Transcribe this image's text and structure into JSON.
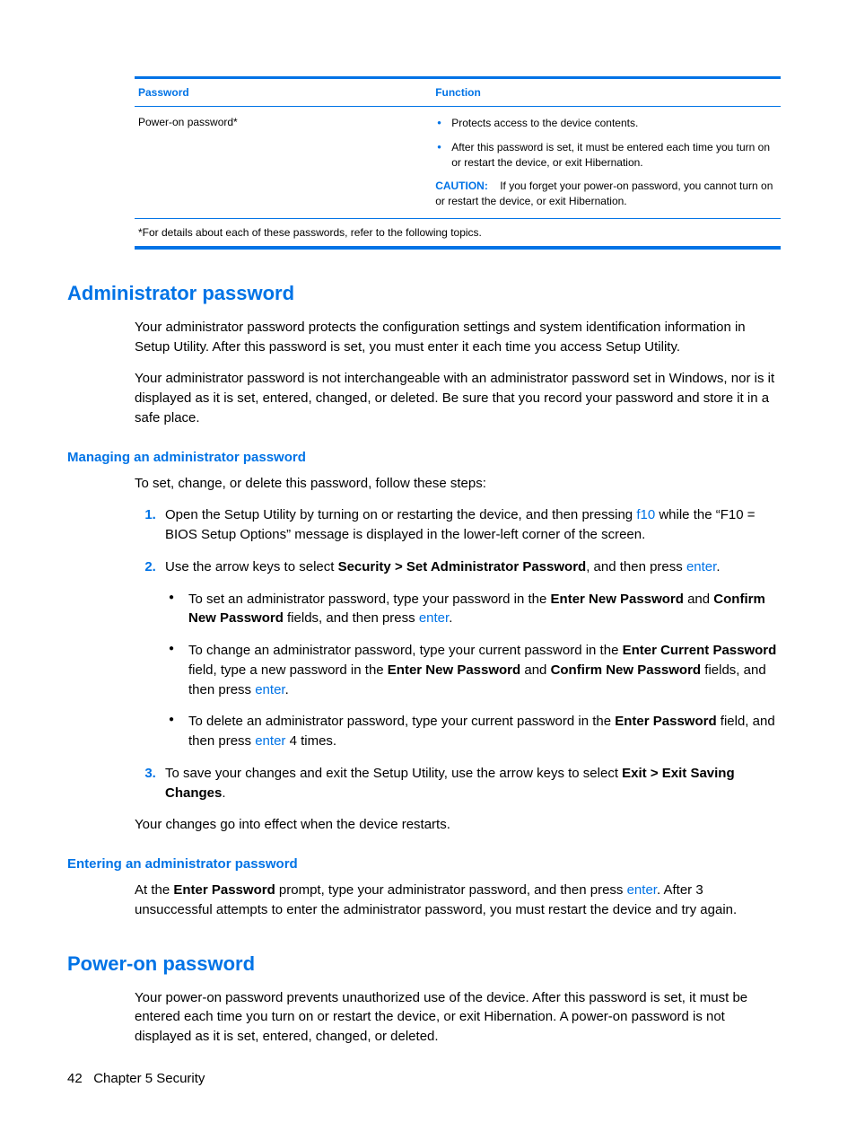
{
  "table": {
    "header": {
      "col1": "Password",
      "col2": "Function"
    },
    "row": {
      "label": "Power-on password*",
      "bullets": [
        "Protects access to the device contents.",
        "After this password is set, it must be entered each time you turn on or restart the device, or exit Hibernation."
      ],
      "caution_label": "CAUTION:",
      "caution_text": "If you forget your power-on password, you cannot turn on or restart the device, or exit Hibernation."
    },
    "footnote": "*For details about each of these passwords, refer to the following topics."
  },
  "sections": {
    "admin": {
      "title": "Administrator password",
      "p1": "Your administrator password protects the configuration settings and system identification information in Setup Utility. After this password is set, you must enter it each time you access Setup Utility.",
      "p2": "Your administrator password is not interchangeable with an administrator password set in Windows, nor is it displayed as it is set, entered, changed, or deleted. Be sure that you record your password and store it in a safe place.",
      "managing": {
        "title": "Managing an administrator password",
        "intro": "To set, change, or delete this password, follow these steps:",
        "step1_a": "Open the Setup Utility by turning on or restarting the device, and then pressing ",
        "step1_key": "f10",
        "step1_b": " while the “F10 = BIOS Setup Options” message is displayed in the lower-left corner of the screen.",
        "step2_a": "Use the arrow keys to select ",
        "step2_bold": "Security > Set Administrator Password",
        "step2_b": ", and then press ",
        "step2_key": "enter",
        "step2_c": ".",
        "sub1_a": "To set an administrator password, type your password in the ",
        "sub1_b1": "Enter New Password",
        "sub1_mid": " and ",
        "sub1_b2": "Confirm New Password",
        "sub1_c": " fields, and then press ",
        "sub1_key": "enter",
        "sub1_d": ".",
        "sub2_a": "To change an administrator password, type your current password in the ",
        "sub2_b1": "Enter Current Password",
        "sub2_mid1": " field, type a new password in the ",
        "sub2_b2": "Enter New Password",
        "sub2_mid2": " and ",
        "sub2_b3": "Confirm New Password",
        "sub2_c": " fields, and then press ",
        "sub2_key": "enter",
        "sub2_d": ".",
        "sub3_a": "To delete an administrator password, type your current password in the ",
        "sub3_b1": "Enter Password",
        "sub3_c": " field, and then press ",
        "sub3_key": "enter",
        "sub3_d": " 4 times.",
        "step3_a": "To save your changes and exit the Setup Utility, use the arrow keys to select ",
        "step3_bold": "Exit > Exit Saving Changes",
        "step3_b": ".",
        "outro": "Your changes go into effect when the device restarts."
      },
      "entering": {
        "title": "Entering an administrator password",
        "p_a": "At the ",
        "p_bold": "Enter Password",
        "p_b": " prompt, type your administrator password, and then press ",
        "p_key": "enter",
        "p_c": ". After 3 unsuccessful attempts to enter the administrator password, you must restart the device and try again."
      }
    },
    "poweron": {
      "title": "Power-on password",
      "p1": "Your power-on password prevents unauthorized use of the device. After this password is set, it must be entered each time you turn on or restart the device, or exit Hibernation. A power-on password is not displayed as it is set, entered, changed, or deleted."
    }
  },
  "footer": {
    "page": "42",
    "chapter": "Chapter 5   Security"
  }
}
